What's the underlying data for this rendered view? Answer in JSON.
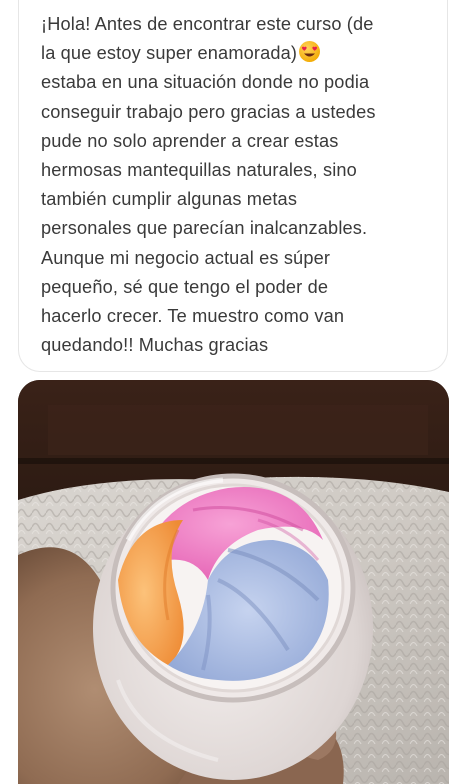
{
  "message": {
    "lines": [
      "¡Hola! Antes de encontrar este curso (de",
      "la que estoy super enamorada)",
      "estaba en una situación donde no podia",
      "conseguir trabajo pero gracias a ustedes",
      "pude no solo aprender a crear estas",
      "hermosas mantequillas naturales, sino",
      "también cumplir algunas metas",
      "personales que parecían inalcanzables.",
      "Aunque mi negocio actual es súper",
      "pequeño, sé que tengo el poder de",
      "hacerlo crecer. Te muestro como van",
      "quedando!! Muchas gracias"
    ],
    "emoji": "smiling-face-with-heart-eyes-emoji",
    "text_color": "#3a3a3a"
  },
  "photo": {
    "subject": "jar-of-rainbow-whipped-body-butter",
    "swirl_colors": [
      "#f07ac4",
      "#f6a24a",
      "#9fb4dc",
      "#b7c7ea"
    ]
  }
}
